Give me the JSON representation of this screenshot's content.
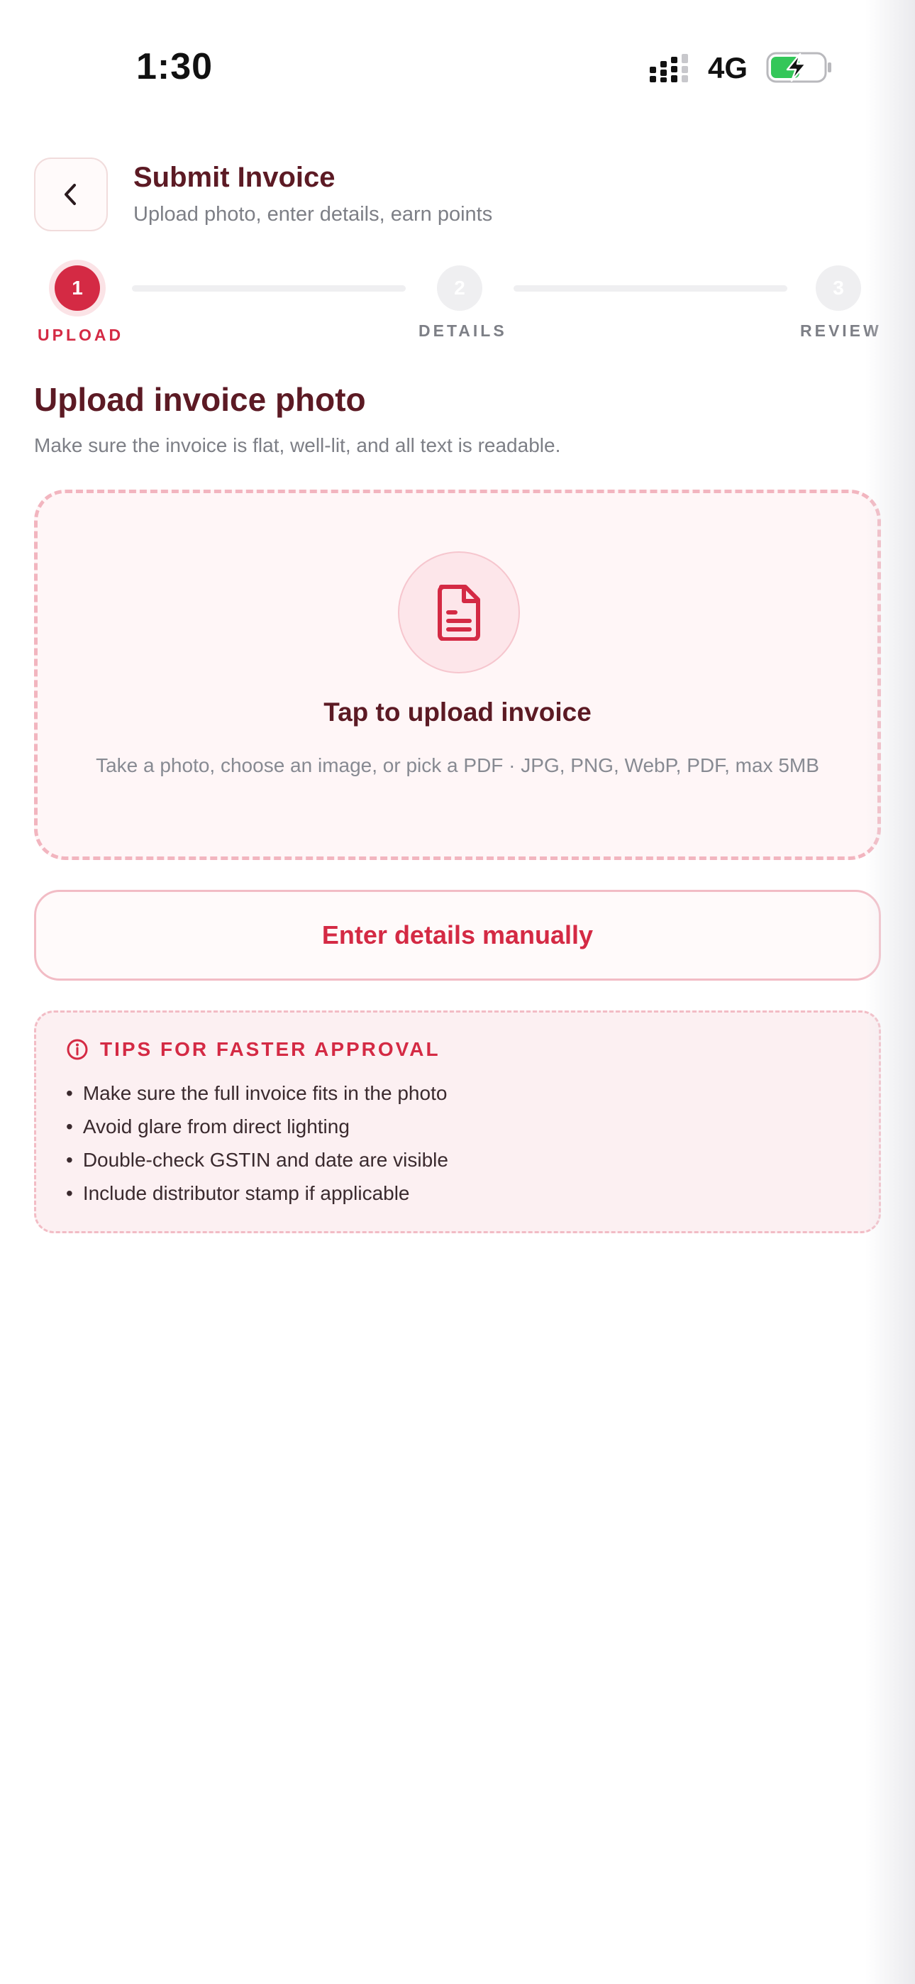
{
  "status_bar": {
    "time": "1:30",
    "network": "4G",
    "battery_color": "#34c759"
  },
  "header": {
    "back_icon": "chevron-left-icon",
    "title": "Submit Invoice",
    "subtitle": "Upload photo, enter details, earn points"
  },
  "stepper": {
    "steps": [
      {
        "number": "1",
        "label": "UPLOAD",
        "active": true
      },
      {
        "number": "2",
        "label": "DETAILS",
        "active": false
      },
      {
        "number": "3",
        "label": "REVIEW",
        "active": false
      }
    ]
  },
  "section": {
    "title": "Upload invoice photo",
    "subtitle": "Make sure the invoice is flat, well-lit, and all text is readable."
  },
  "upload": {
    "icon": "document-icon",
    "title": "Tap to upload invoice",
    "subtitle": "Take a photo, choose an image, or pick a PDF · JPG, PNG, WebP, PDF, max 5MB"
  },
  "manual_button": {
    "label": "Enter details manually"
  },
  "tips": {
    "icon": "info-icon",
    "title": "TIPS FOR FASTER APPROVAL",
    "items": [
      "Make sure the full invoice fits in the photo",
      "Avoid glare from direct lighting",
      "Double-check GSTIN and date are visible",
      "Include distributor stamp if applicable"
    ]
  },
  "colors": {
    "accent": "#d42a44",
    "heading": "#5c1a24",
    "muted": "#7d7f86"
  }
}
